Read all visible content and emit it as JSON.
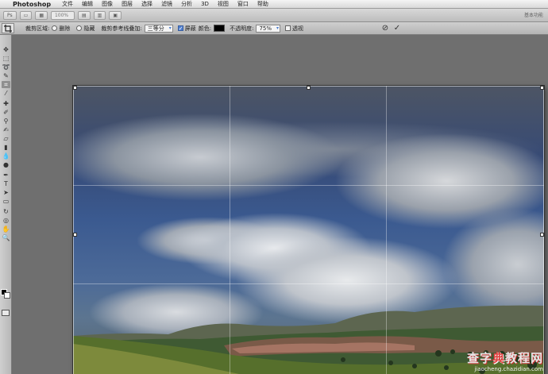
{
  "menubar": {
    "app_name": "Photoshop",
    "items": [
      "文件",
      "编辑",
      "图像",
      "图层",
      "选择",
      "滤镜",
      "分析",
      "3D",
      "视图",
      "窗口",
      "帮助"
    ]
  },
  "appbar": {
    "zoom": "100%",
    "workspace": "基本功能"
  },
  "options": {
    "shield_label": "裁剪区域:",
    "delete_label": "删除",
    "hide_label": "隐藏",
    "overlay_label": "裁剪参考线叠加:",
    "overlay_value": "三等分",
    "shield_checkbox_label": "屏蔽",
    "color_label": "颜色:",
    "opacity_label": "不透明度:",
    "opacity_value": "75%",
    "perspective_label": "透视",
    "shield_checked": true,
    "perspective_checked": false
  },
  "colors": {
    "foreground": "#000000",
    "background": "#ffffff",
    "shield_color": "#000000"
  },
  "watermark": {
    "line1_a": "查字",
    "line1_b": "典",
    "line1_c": "教程网",
    "line2": "jiaocheng.chazidian.com"
  }
}
